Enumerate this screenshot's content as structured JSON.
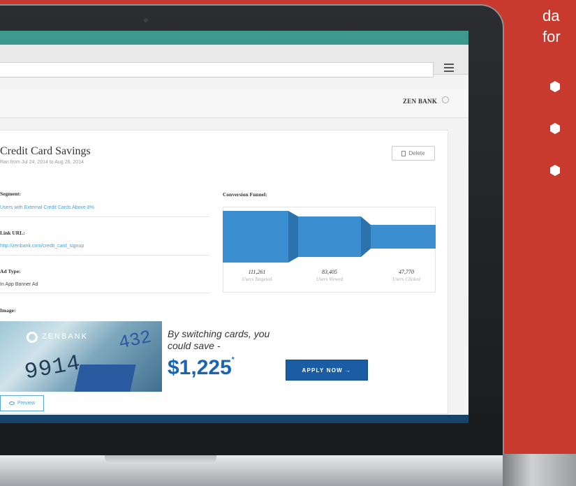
{
  "side_text": {
    "line1": "da",
    "line2": "for"
  },
  "app": {
    "brand": "ZEN BANK",
    "campaign_title": "Credit Card Savings",
    "campaign_dates": "Ran from Jul 24, 2014 to Aug 26, 2014",
    "delete_label": "Delete",
    "fields": [
      {
        "label": "Segment:",
        "value": "Users with External Credit Cards Above 8%"
      },
      {
        "label": "Link URL:",
        "value": "http://zenbank.com/credit_card_signup"
      },
      {
        "label": "Ad Type:",
        "value": "In App Banner Ad"
      }
    ],
    "image_label": "Image:",
    "preview_label": "Preview",
    "funnel": {
      "label": "Conversion Funnel:",
      "stats": [
        {
          "value": "111,261",
          "caption": "Users Targeted"
        },
        {
          "value": "83,405",
          "caption": "Users Viewed"
        },
        {
          "value": "47,770",
          "caption": "Users Clicked"
        }
      ]
    },
    "banner": {
      "brand": "ZENBANK",
      "card_number": "9914",
      "card_number_partial": "432",
      "copy": "By switching cards, you could save -",
      "amount": "$1,225",
      "amount_mark": "*",
      "cta": "APPLY NOW →"
    }
  },
  "colors": {
    "background_red": "#c8392e",
    "funnel_blue": "#3b8fd0",
    "accent_blue": "#1a5da5",
    "link_blue": "#4a9fd8"
  }
}
